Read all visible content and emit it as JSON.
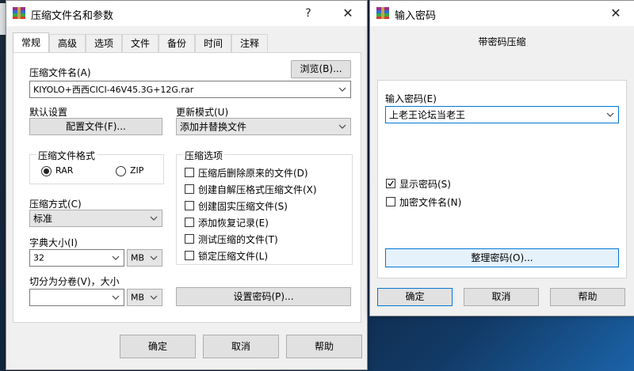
{
  "left_window": {
    "title": "压缩文件名和参数",
    "help_symbol": "?",
    "close_symbol": "✕",
    "tabs": [
      "常规",
      "高级",
      "选项",
      "文件",
      "备份",
      "时间",
      "注释"
    ],
    "archive_name_label": "压缩文件名(A)",
    "browse_label": "浏览(B)...",
    "archive_name_value": "KIYOLO+西西CICI-46V45.3G+12G.rar",
    "default_settings_label": "默认设置",
    "profiles_label": "配置文件(F)...",
    "update_mode_label": "更新模式(U)",
    "update_mode_value": "添加并替换文件",
    "format_group_title": "压缩文件格式",
    "format_rar": "RAR",
    "format_zip": "ZIP",
    "options_group_title": "压缩选项",
    "options": [
      {
        "label": "压缩后删除原来的文件(D)",
        "checked": false
      },
      {
        "label": "创建自解压格式压缩文件(X)",
        "checked": false
      },
      {
        "label": "创建固实压缩文件(S)",
        "checked": false
      },
      {
        "label": "添加恢复记录(E)",
        "checked": false
      },
      {
        "label": "测试压缩的文件(T)",
        "checked": false
      },
      {
        "label": "锁定压缩文件(L)",
        "checked": false
      }
    ],
    "method_label": "压缩方式(C)",
    "method_value": "标准",
    "dict_label": "字典大小(I)",
    "dict_value": "32",
    "dict_unit": "MB",
    "split_label": "切分为分卷(V)，大小",
    "split_value": "",
    "split_unit": "MB",
    "set_password_label": "设置密码(P)...",
    "ok_label": "确定",
    "cancel_label": "取消",
    "help_label": "帮助"
  },
  "right_window": {
    "title": "输入密码",
    "close_symbol": "✕",
    "heading": "带密码压缩",
    "password_label": "输入密码(E)",
    "password_value": "上老王论坛当老王",
    "show_password_label": "显示密码(S)",
    "show_password_checked": true,
    "encrypt_names_label": "加密文件名(N)",
    "encrypt_names_checked": false,
    "organize_label": "整理密码(O)...",
    "ok_label": "确定",
    "cancel_label": "取消",
    "help_label": "帮助"
  },
  "colors": {
    "accent": "#0078d7",
    "dialog_bg": "#f0f0f0",
    "panel_bg": "#ffffff"
  }
}
